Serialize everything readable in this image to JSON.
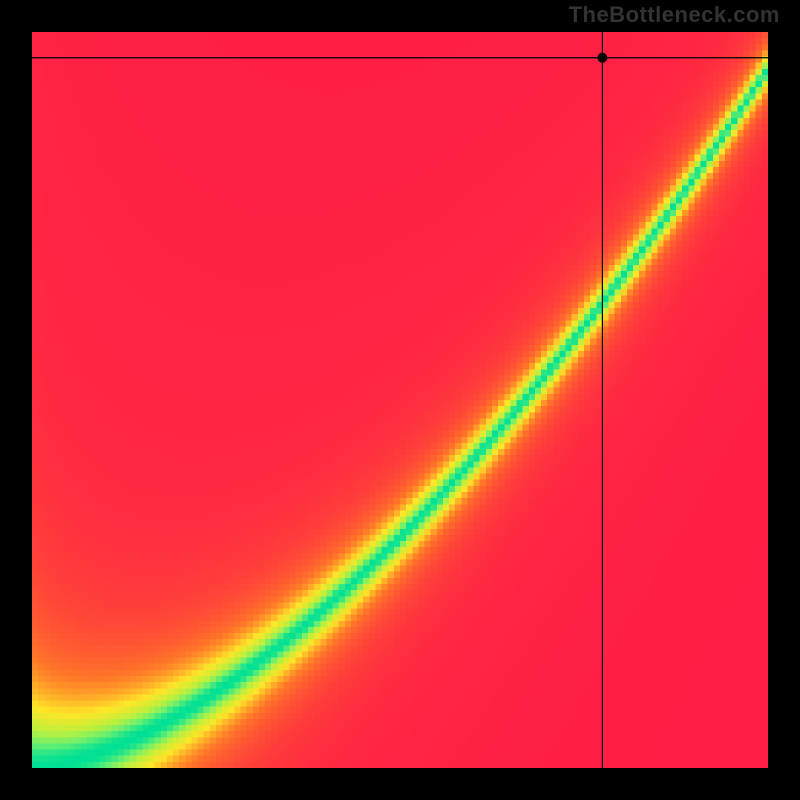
{
  "watermark": "TheBottleneck.com",
  "chart_data": {
    "type": "heatmap",
    "title": "",
    "xlabel": "",
    "ylabel": "",
    "xlim": [
      0,
      1
    ],
    "ylim": [
      0,
      1
    ],
    "grid_size": 120,
    "ridge_exponent": 1.6,
    "ridge_scale": 0.95,
    "ridge_offset": 0.0,
    "tightness_min": 12,
    "tightness_max": 55,
    "marker": {
      "x": 0.775,
      "y": 0.965
    },
    "palette_note": "red→orange→yellow→green (large deviation → small)",
    "value_note": "color = deviation of y from ideal ridge at x; 0 deviation = green"
  }
}
